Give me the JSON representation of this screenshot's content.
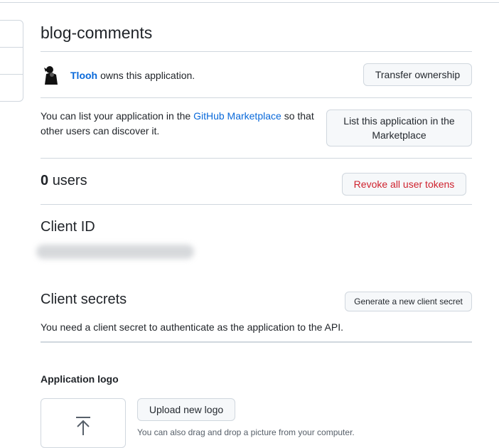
{
  "app": {
    "title": "blog-comments"
  },
  "owner": {
    "name": "Tlooh",
    "text": "owns this application.",
    "transfer_button": "Transfer ownership"
  },
  "marketplace": {
    "text_before": "You can list your application in the",
    "link": "GitHub Marketplace",
    "text_after": "so that other users can discover it.",
    "button_line1": "List this application in the",
    "button_line2": "Marketplace"
  },
  "users": {
    "count": "0",
    "label": "users",
    "revoke_button": "Revoke all user tokens"
  },
  "client_id": {
    "heading": "Client ID"
  },
  "client_secrets": {
    "heading": "Client secrets",
    "generate_button": "Generate a new client secret",
    "note": "You need a client secret to authenticate as the application to the API."
  },
  "logo": {
    "heading": "Application logo",
    "upload_button": "Upload new logo",
    "drag_note": "You can also drag and drop a picture from your computer."
  },
  "colors": {
    "link": "#0969da",
    "danger": "#cf222e",
    "border": "#d0d7de",
    "button_bg": "#f6f8fa"
  }
}
